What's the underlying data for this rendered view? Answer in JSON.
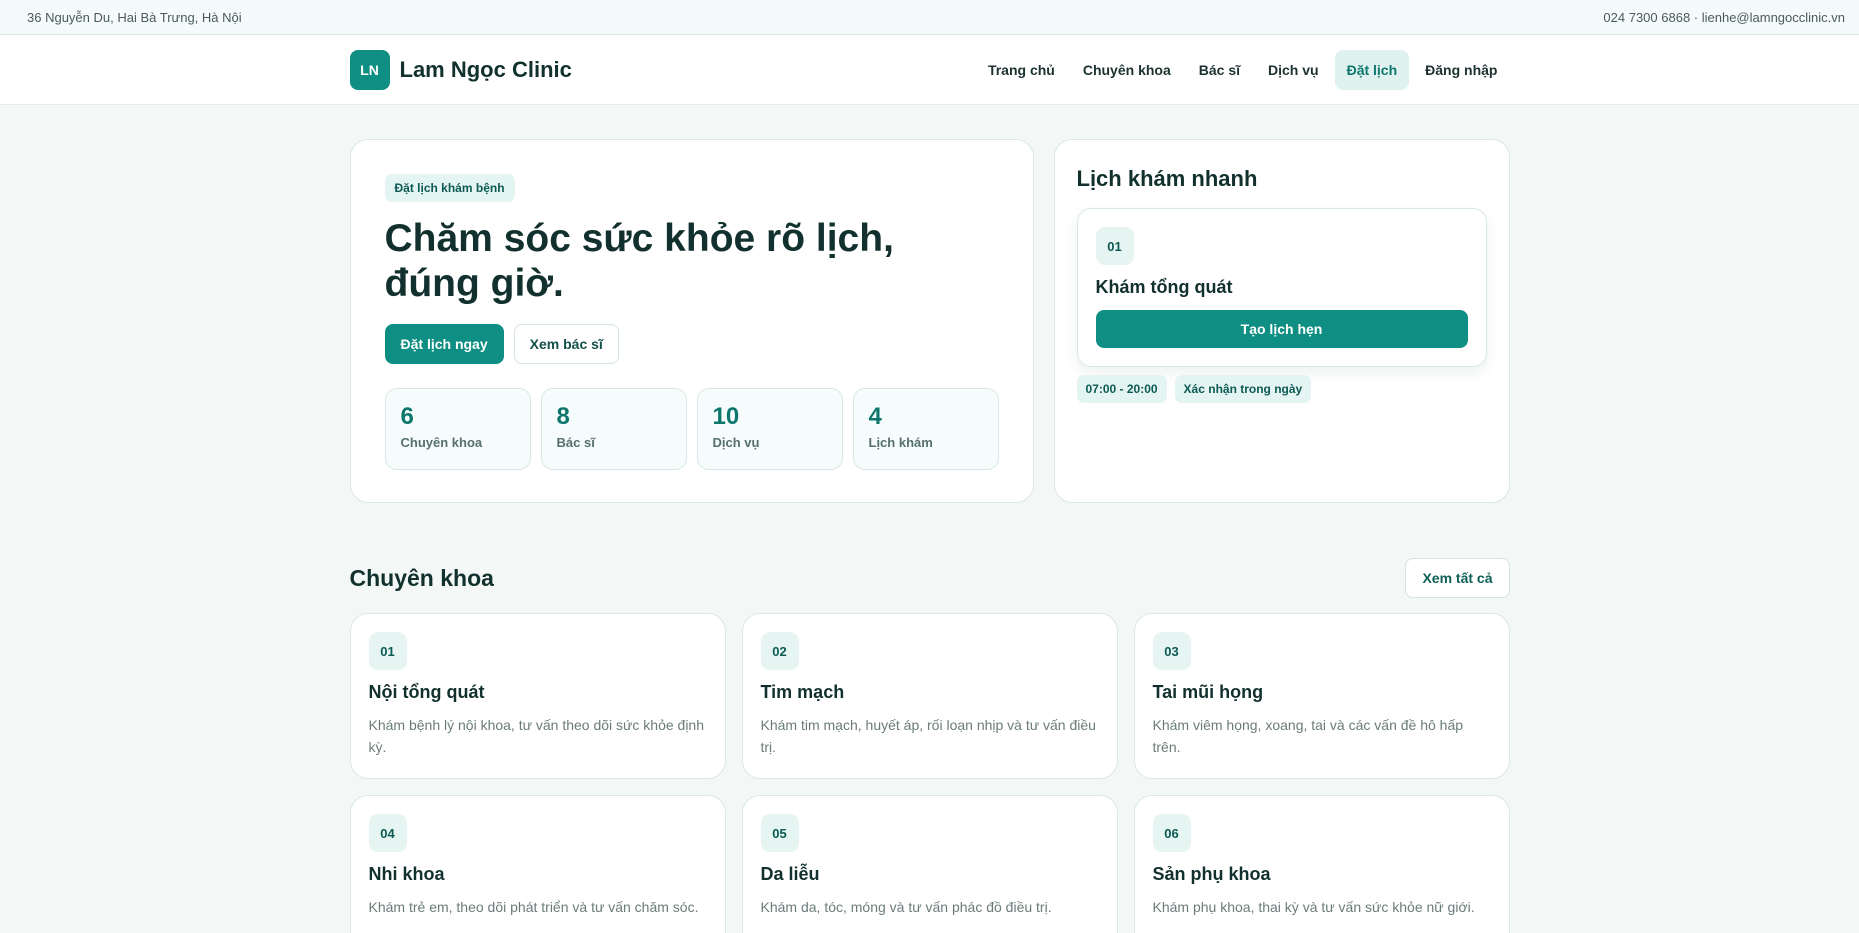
{
  "topbar": {
    "address": "36 Nguyễn Du, Hai Bà Trưng, Hà Nội",
    "contact": "024 7300 6868 · lienhe@lamngocclinic.vn"
  },
  "header": {
    "logo_initials": "LN",
    "brand_name": "Lam Ngọc Clinic",
    "nav": [
      {
        "label": "Trang chủ"
      },
      {
        "label": "Chuyên khoa"
      },
      {
        "label": "Bác sĩ"
      },
      {
        "label": "Dịch vụ"
      },
      {
        "label": "Đặt lịch",
        "active": true
      },
      {
        "label": "Đăng nhập"
      }
    ]
  },
  "hero": {
    "badge": "Đặt lịch khám bệnh",
    "title": "Chăm sóc sức khỏe rõ lịch, đúng giờ.",
    "primary_button": "Đặt lịch ngay",
    "secondary_button": "Xem bác sĩ",
    "stats": [
      {
        "value": "6",
        "label": "Chuyên khoa"
      },
      {
        "value": "8",
        "label": "Bác sĩ"
      },
      {
        "value": "10",
        "label": "Dịch vụ"
      },
      {
        "value": "4",
        "label": "Lịch khám"
      }
    ]
  },
  "quick": {
    "title": "Lịch khám nhanh",
    "number": "01",
    "service": "Khám tổng quát",
    "button": "Tạo lịch hẹn",
    "tags": [
      "07:00 - 20:00",
      "Xác nhận trong ngày"
    ]
  },
  "specialties": {
    "title": "Chuyên khoa",
    "view_all": "Xem tất cả",
    "items": [
      {
        "number": "01",
        "name": "Nội tổng quát",
        "desc": "Khám bệnh lý nội khoa, tư vấn theo dõi sức khỏe định kỳ."
      },
      {
        "number": "02",
        "name": "Tim mạch",
        "desc": "Khám tim mạch, huyết áp, rối loạn nhịp và tư vấn điều trị."
      },
      {
        "number": "03",
        "name": "Tai mũi họng",
        "desc": "Khám viêm họng, xoang, tai và các vấn đề hô hấp trên."
      },
      {
        "number": "04",
        "name": "Nhi khoa",
        "desc": "Khám trẻ em, theo dõi phát triển và tư vấn chăm sóc."
      },
      {
        "number": "05",
        "name": "Da liễu",
        "desc": "Khám da, tóc, móng và tư vấn phác đồ điều trị."
      },
      {
        "number": "06",
        "name": "Sản phụ khoa",
        "desc": "Khám phụ khoa, thai kỳ và tư vấn sức khỏe nữ giới."
      }
    ]
  },
  "colors": {
    "accent": "#0f8f84",
    "text": "#12312e",
    "background": "#f3f8f7"
  }
}
